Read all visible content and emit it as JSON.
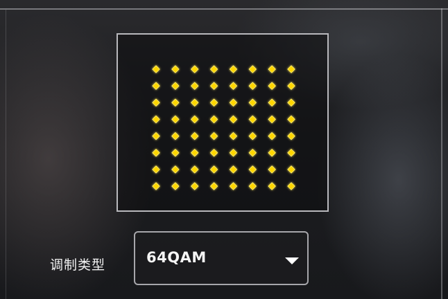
{
  "constellation": {
    "rows": 8,
    "cols": 8,
    "point_color": "#ffd600",
    "glow_color": "#ffef70"
  },
  "modulation": {
    "label": "调制类型",
    "selected": "64QAM",
    "arrow_icon": "chevron-down-icon"
  }
}
